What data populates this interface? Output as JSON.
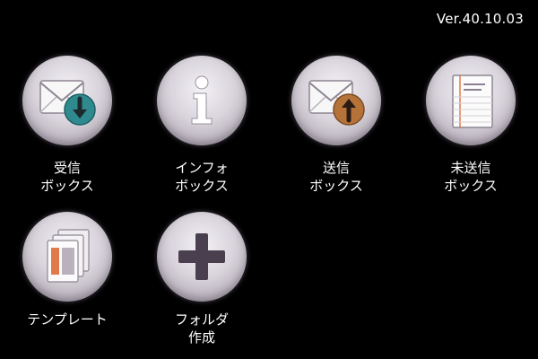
{
  "header": {
    "version": "Ver.40.10.03"
  },
  "tiles": [
    {
      "line1": "受信",
      "line2": "ボックス",
      "icon": "inbox-envelope-down-arrow-icon",
      "badge_color": "#2f8a8f"
    },
    {
      "line1": "インフォ",
      "line2": "ボックス",
      "icon": "info-icon"
    },
    {
      "line1": "送信",
      "line2": "ボックス",
      "icon": "outbox-envelope-up-arrow-icon",
      "badge_color": "#b5733a"
    },
    {
      "line1": "未送信",
      "line2": "ボックス",
      "icon": "notepad-icon"
    },
    {
      "line1": "テンプレート",
      "line2": "",
      "icon": "template-stack-icon"
    },
    {
      "line1": "フォルダ",
      "line2": "作成",
      "icon": "plus-icon"
    }
  ],
  "colors": {
    "background": "#000000",
    "text": "#ffffff",
    "icon_dark": "#4a3f4e"
  }
}
